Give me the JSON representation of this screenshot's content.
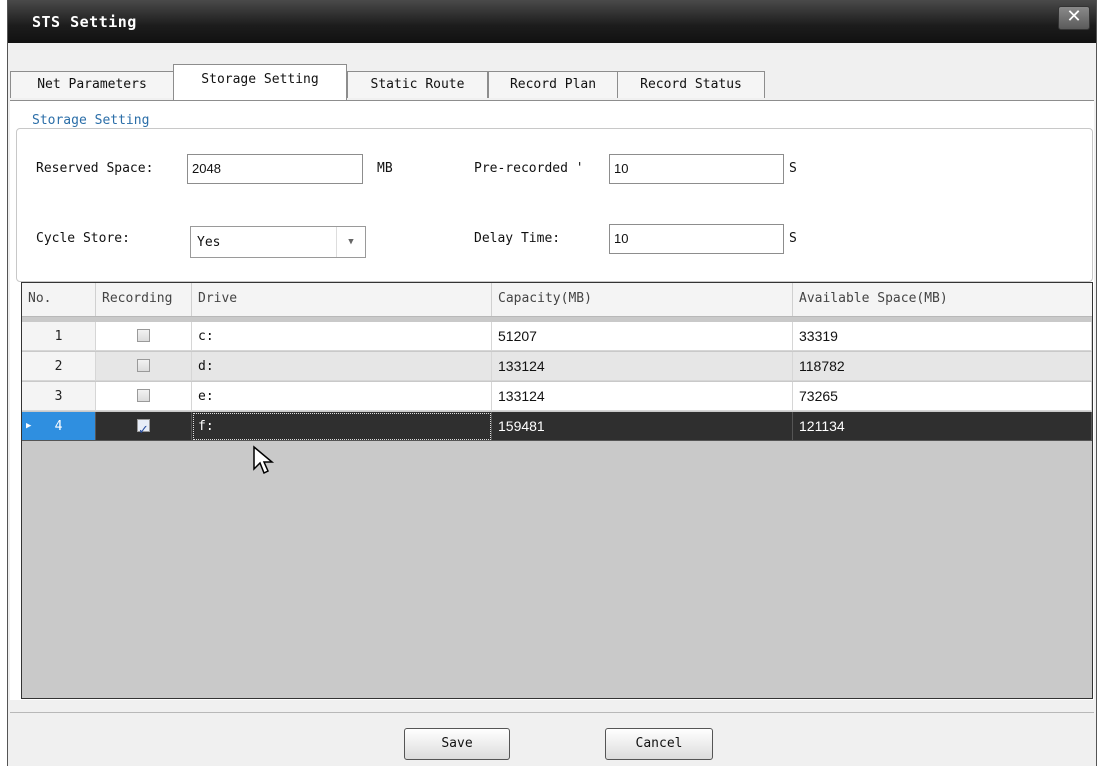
{
  "window": {
    "title": "STS Setting",
    "close_label": "✕"
  },
  "tabs": [
    {
      "label": "Net Parameters"
    },
    {
      "label": "Storage Setting"
    },
    {
      "label": "Static Route"
    },
    {
      "label": "Record Plan"
    },
    {
      "label": "Record Status"
    }
  ],
  "storage": {
    "legend": "Storage Setting",
    "reserved_label": "Reserved Space:",
    "reserved_value": "2048",
    "reserved_unit": "MB",
    "prerecord_label": "Pre-recorded '",
    "prerecord_value": "10",
    "prerecord_unit": "S",
    "cycle_label": "Cycle Store:",
    "cycle_value": "Yes",
    "delay_label": "Delay Time:",
    "delay_value": "10",
    "delay_unit": "S"
  },
  "table": {
    "headers": [
      "No.",
      "Recording",
      "Drive",
      "Capacity(MB)",
      "Available Space(MB)"
    ],
    "rows": [
      {
        "no": "1",
        "recording": false,
        "drive": "c:",
        "capacity": "51207",
        "available": "33319"
      },
      {
        "no": "2",
        "recording": false,
        "drive": "d:",
        "capacity": "133124",
        "available": "118782"
      },
      {
        "no": "3",
        "recording": false,
        "drive": "e:",
        "capacity": "133124",
        "available": "73265"
      },
      {
        "no": "4",
        "recording": true,
        "drive": "f:",
        "capacity": "159481",
        "available": "121134"
      }
    ],
    "selected_row": 4
  },
  "buttons": {
    "save": "Save",
    "cancel": "Cancel"
  }
}
